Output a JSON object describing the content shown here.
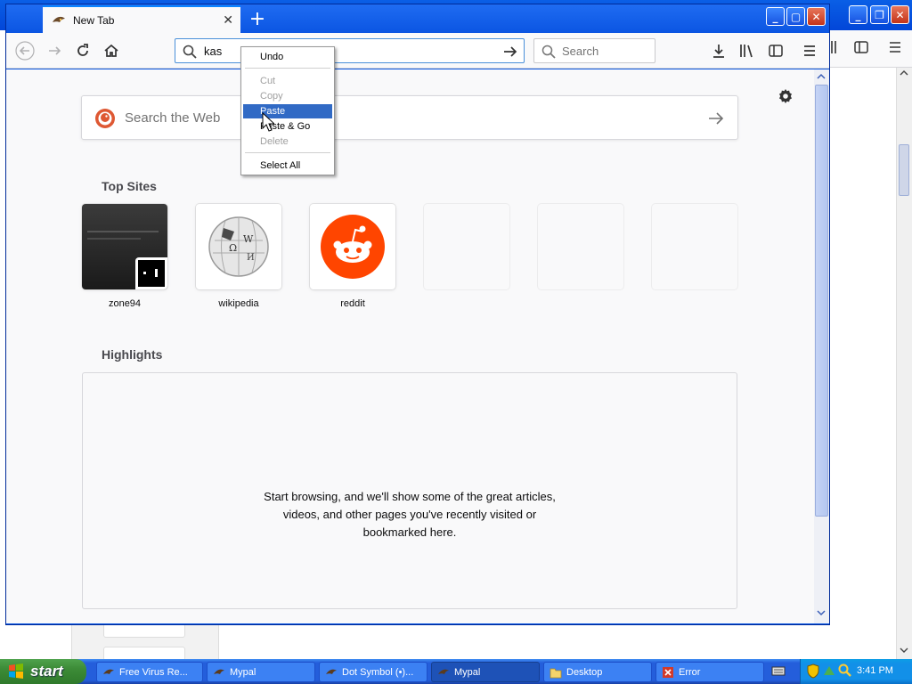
{
  "browser": {
    "tab_title": "New Tab",
    "new_tab_symbol": "+",
    "tab_close_symbol": "✕",
    "url_value": "kas",
    "search_placeholder": "Search",
    "accent": "#0a84ff"
  },
  "newtab": {
    "web_search_placeholder": "Search the Web",
    "top_sites_title": "Top Sites",
    "top_sites": [
      {
        "label": "zone94"
      },
      {
        "label": "wikipedia"
      },
      {
        "label": "reddit"
      },
      {
        "label": ""
      },
      {
        "label": ""
      },
      {
        "label": ""
      }
    ],
    "highlights_title": "Highlights",
    "highlights_message_lines": [
      "Start browsing, and we'll show some of the great articles,",
      "videos, and other pages you've recently visited or",
      "bookmarked here."
    ]
  },
  "context_menu": {
    "items": [
      {
        "label": "Undo",
        "enabled": true
      },
      {
        "label": "Cut",
        "enabled": false
      },
      {
        "label": "Copy",
        "enabled": false
      },
      {
        "label": "Paste",
        "enabled": true,
        "highlighted": true
      },
      {
        "label": "Paste & Go",
        "enabled": true
      },
      {
        "label": "Delete",
        "enabled": false
      },
      {
        "label": "Select All",
        "enabled": true
      }
    ]
  },
  "taskbar": {
    "start_label": "start",
    "tasks": [
      {
        "label": "Free Virus Re...",
        "icon": "browser-icon"
      },
      {
        "label": "Mypal",
        "icon": "mypal-icon"
      },
      {
        "label": "Dot Symbol (•)...",
        "icon": "mypal-icon"
      },
      {
        "label": "Mypal",
        "icon": "mypal-icon",
        "active": true
      },
      {
        "label": "Desktop",
        "icon": "folder-icon"
      },
      {
        "label": "Error",
        "icon": "error-icon"
      }
    ],
    "clock": "3:41 PM"
  }
}
